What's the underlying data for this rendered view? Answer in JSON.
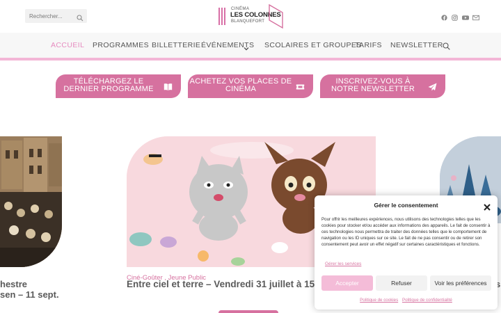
{
  "header": {
    "search": {
      "placeholder": "Rechercher..."
    },
    "logo": {
      "cinema": "CINÉMA",
      "name": "LES COLONNES",
      "city": "BLANQUEFORT"
    },
    "social": [
      "facebook-icon",
      "instagram-icon",
      "youtube-icon",
      "mail-icon"
    ]
  },
  "nav": {
    "items": [
      {
        "label": "ACCUEIL",
        "active": true
      },
      {
        "label": "PROGRAMMES"
      },
      {
        "label": "BILLETTERIE"
      },
      {
        "label": "ÉVÉNEMENTS"
      },
      {
        "label": "SCOLAIRES ET GROUPES"
      },
      {
        "label": "TARIFS"
      },
      {
        "label": "NEWSLETTER"
      }
    ]
  },
  "ctas": [
    {
      "line1": "TÉLÉCHARGEZ LE",
      "line2": "DERNIER PROGRAMME",
      "icon": "book-icon"
    },
    {
      "line1": "ACHETEZ VOS PLACES DE",
      "line2": "CINÉMA",
      "icon": "ticket-icon"
    },
    {
      "line1": "INSCRIVEZ-VOUS À",
      "line2": "NOTRE NEWSLETTER",
      "icon": "paper-plane-icon"
    }
  ],
  "slides": {
    "left": {
      "caption_line1": "hestre",
      "caption_line2": "sen – 11 sept."
    },
    "main": {
      "category": "Ciné-Goûter , Jeune Public",
      "title": "Entre ciel et terre – Vendredi 31 juillet à 15h45"
    },
    "right": {
      "caption": "s"
    }
  },
  "consent": {
    "title": "Gérer le consentement",
    "body": "Pour offrir les meilleures expériences, nous utilisons des technologies telles que les cookies pour stocker et/ou accéder aux informations des appareils. Le fait de consentir à ces technologies nous permettra de traiter des données telles que le comportement de navigation ou les ID uniques sur ce site. Le fait de ne pas consentir ou de retirer son consentement peut avoir un effet négatif sur certaines caractéristiques et fonctions.",
    "manage": "Gérer les services",
    "accept": "Accepter",
    "refuse": "Refuser",
    "prefs": "Voir les préférences",
    "cookie_policy": "Politique de cookies",
    "privacy_policy": "Politique de confidentialité"
  },
  "colors": {
    "accent": "#d6719f",
    "accent_light": "#f3b6d6",
    "nav_bg": "#f7f7f7"
  }
}
